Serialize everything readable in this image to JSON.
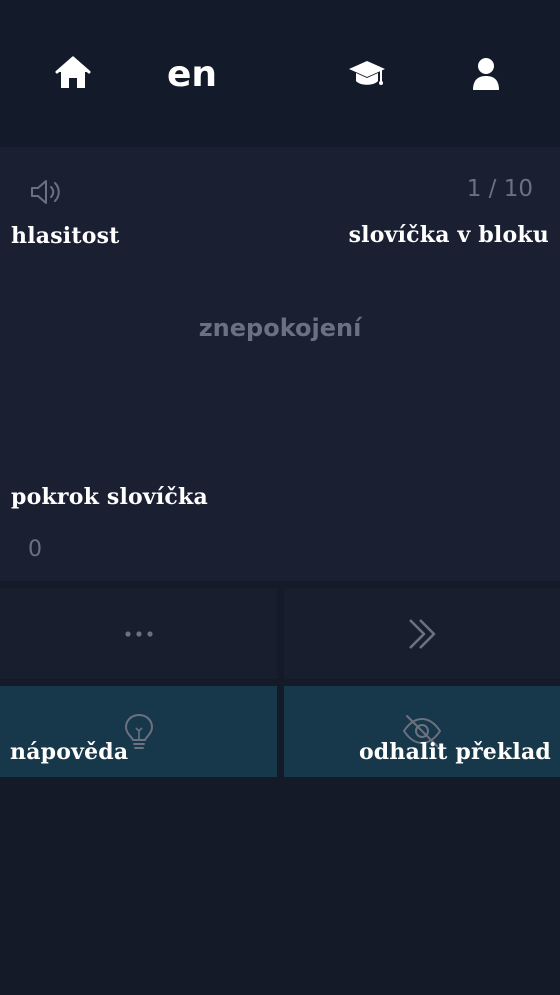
{
  "header": {
    "language": "en",
    "icons": {
      "home": "home-icon",
      "courses": "graduation-cap-icon",
      "profile": "user-icon"
    }
  },
  "card": {
    "volume_label": "hlasitost",
    "counter": "1 / 10",
    "counter_label": "slovíčka v bloku",
    "word": "znepokojení",
    "progress_label": "pokrok slovíčka",
    "progress_value": "0"
  },
  "actions": {
    "hint_label": "nápověda",
    "reveal_label": "odhalit překlad",
    "icons": {
      "more": "more-dots-icon",
      "skip": "double-chevron-right-icon",
      "hint": "lightbulb-icon",
      "reveal": "eye-off-icon"
    }
  },
  "colors": {
    "background": "#141a28",
    "card": "#1a2031",
    "button_dark": "#181e2e",
    "button_teal": "#17384a",
    "muted": "#6b7180"
  }
}
